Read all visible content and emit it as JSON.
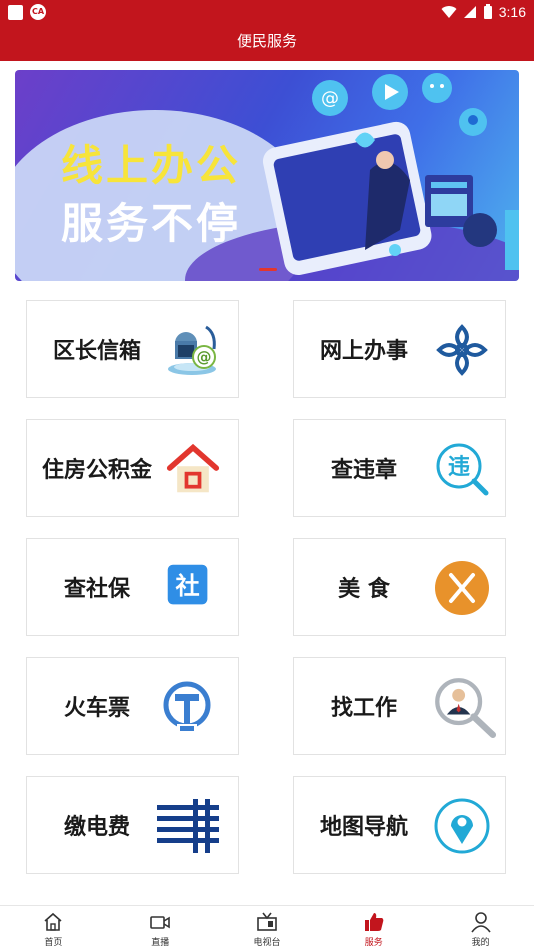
{
  "status_bar": {
    "time": "3:16",
    "notification_badge": "CA"
  },
  "header": {
    "title": "便民服务"
  },
  "banner": {
    "line1": "线上办公",
    "line2": "服务不停"
  },
  "services": [
    {
      "label": "区长信箱",
      "icon": "mailbox-at-icon"
    },
    {
      "label": "网上办事",
      "icon": "knot-icon"
    },
    {
      "label": "住房公积金",
      "icon": "house-icon"
    },
    {
      "label": "查违章",
      "icon": "violation-search-icon"
    },
    {
      "label": "查社保",
      "icon": "social-security-icon"
    },
    {
      "label": "美 食",
      "icon": "fork-knife-icon"
    },
    {
      "label": "火车票",
      "icon": "railway-logo-icon"
    },
    {
      "label": "找工作",
      "icon": "job-search-icon"
    },
    {
      "label": "缴电费",
      "icon": "power-grid-icon"
    },
    {
      "label": "地图导航",
      "icon": "map-pin-icon"
    }
  ],
  "tabs": [
    {
      "label": "首页",
      "icon": "home-icon"
    },
    {
      "label": "直播",
      "icon": "video-camera-icon"
    },
    {
      "label": "电视台",
      "icon": "tv-icon"
    },
    {
      "label": "服务",
      "icon": "thumbs-up-icon",
      "active": true
    },
    {
      "label": "我的",
      "icon": "person-icon"
    }
  ],
  "colors": {
    "brand": "#c2151d",
    "card_border": "#e2e2e2"
  }
}
